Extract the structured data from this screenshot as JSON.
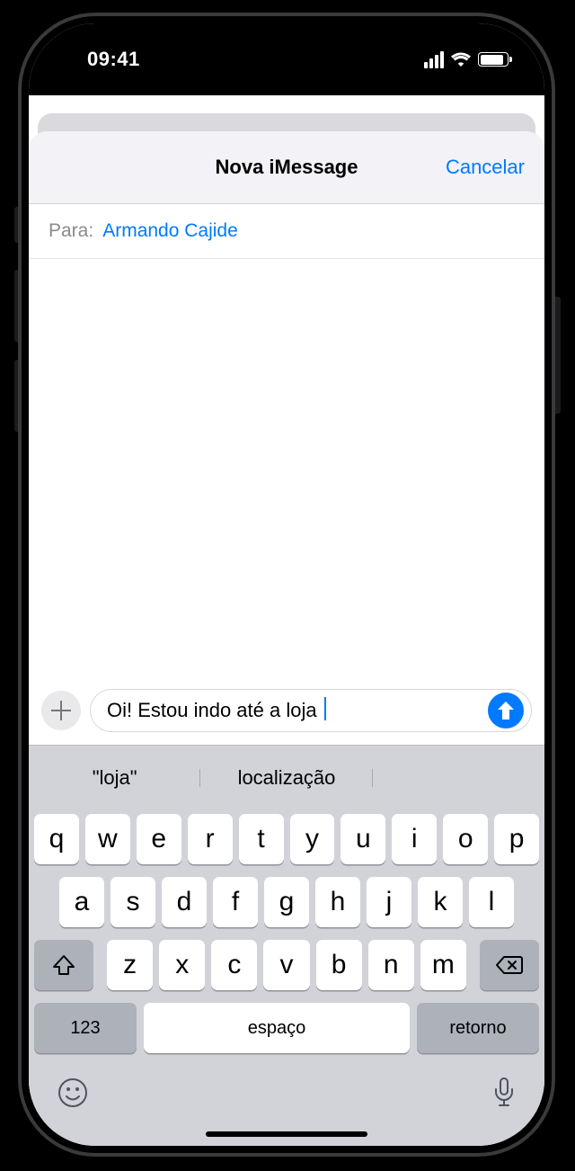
{
  "status": {
    "time": "09:41"
  },
  "header": {
    "title": "Nova iMessage",
    "cancel": "Cancelar"
  },
  "to": {
    "label": "Para:",
    "name": "Armando Cajide"
  },
  "compose": {
    "text": "Oi! Estou indo até a loja"
  },
  "suggestions": {
    "s1": "\"loja\"",
    "s2": "localização"
  },
  "keyboard": {
    "row1": [
      "q",
      "w",
      "e",
      "r",
      "t",
      "y",
      "u",
      "i",
      "o",
      "p"
    ],
    "row2": [
      "a",
      "s",
      "d",
      "f",
      "g",
      "h",
      "j",
      "k",
      "l"
    ],
    "row3": [
      "z",
      "x",
      "c",
      "v",
      "b",
      "n",
      "m"
    ],
    "numkey": "123",
    "space": "espaço",
    "return": "retorno"
  }
}
